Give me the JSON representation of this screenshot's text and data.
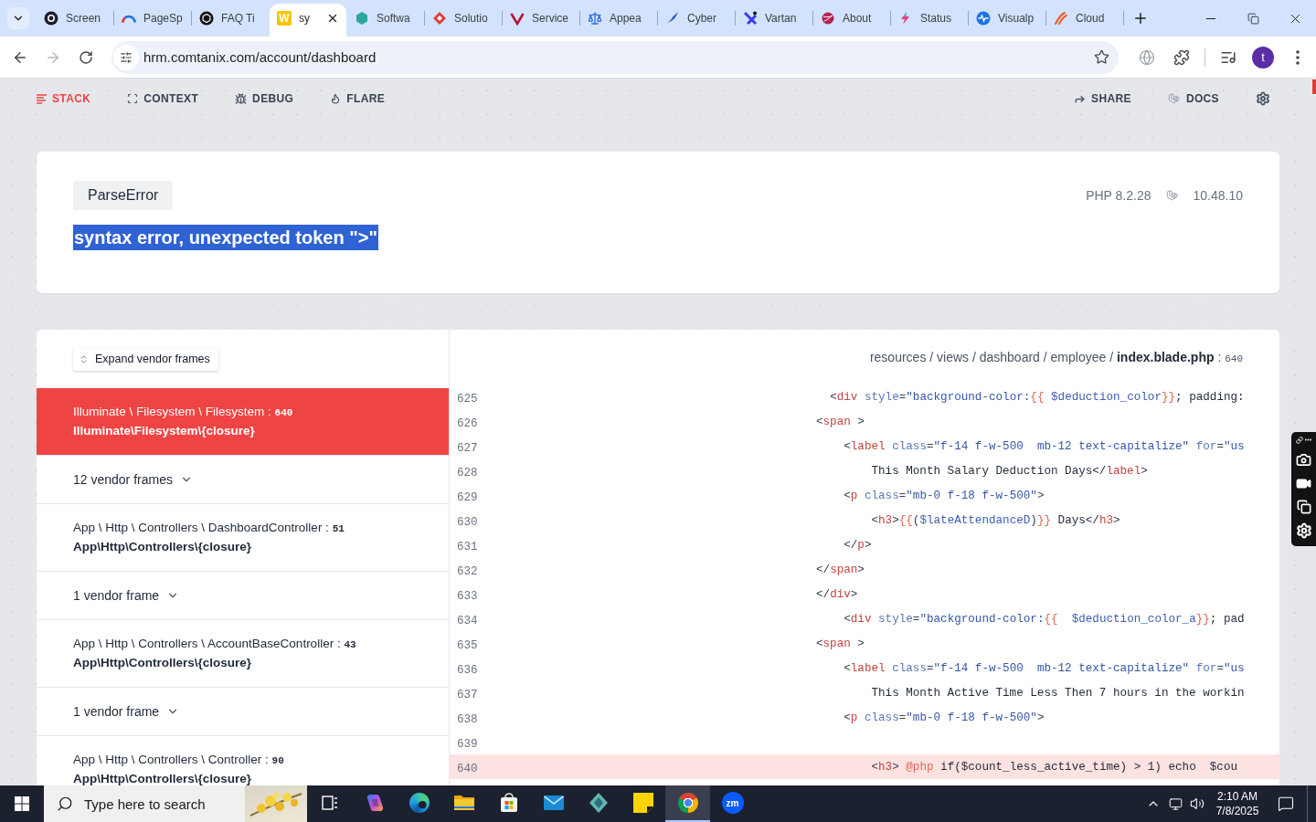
{
  "browser": {
    "tabs": [
      {
        "title": "Screen",
        "selected": false
      },
      {
        "title": "PageSp",
        "selected": false
      },
      {
        "title": "FAQ Ti",
        "selected": false
      },
      {
        "title": "sy",
        "selected": true,
        "favicon_text": "W"
      },
      {
        "title": "Softwa",
        "selected": false
      },
      {
        "title": "Solutio",
        "selected": false
      },
      {
        "title": "Service",
        "selected": false
      },
      {
        "title": "Appea",
        "selected": false
      },
      {
        "title": "Cyber",
        "selected": false
      },
      {
        "title": "Vartan",
        "selected": false
      },
      {
        "title": "About",
        "selected": false
      },
      {
        "title": "Status",
        "selected": false
      },
      {
        "title": "Visualp",
        "selected": false
      },
      {
        "title": "Cloud",
        "selected": false
      }
    ],
    "navigation": {
      "back_disabled": false,
      "forward_disabled": true
    },
    "address": {
      "url": "hrm.comtanix.com/account/dashboard"
    },
    "profile": {
      "initial": "t"
    }
  },
  "page": {
    "nav": {
      "left": [
        {
          "label": "STACK",
          "selected": true
        },
        {
          "label": "CONTEXT",
          "selected": false
        },
        {
          "label": "DEBUG",
          "selected": false
        },
        {
          "label": "FLARE",
          "selected": false
        }
      ],
      "right": [
        {
          "label": "SHARE"
        },
        {
          "label": "DOCS"
        }
      ]
    },
    "exception": {
      "class": "ParseError",
      "message": "syntax error, unexpected token \">\"",
      "text_selected": true,
      "php_version": "PHP 8.2.28",
      "laravel_version": "10.48.10"
    },
    "stack": {
      "expand_label": "Expand vendor frames",
      "frames": [
        {
          "kind": "frame",
          "location": "Illuminate \\ Filesystem \\ Filesystem :",
          "line": "640",
          "method": "Illuminate\\Filesystem\\{closure}",
          "selected": true
        },
        {
          "kind": "vendor_group",
          "label": "12 vendor frames",
          "expanded": false
        },
        {
          "kind": "frame",
          "location": "App \\ Http \\ Controllers \\ DashboardController :",
          "line": "51",
          "method": "App\\Http\\Controllers\\{closure}",
          "selected": false
        },
        {
          "kind": "vendor_group",
          "label": "1 vendor frame",
          "expanded": false
        },
        {
          "kind": "frame",
          "location": "App \\ Http \\ Controllers \\ AccountBaseController :",
          "line": "43",
          "method": "App\\Http\\Controllers\\{closure}",
          "selected": false
        },
        {
          "kind": "vendor_group",
          "label": "1 vendor frame",
          "expanded": false
        },
        {
          "kind": "frame",
          "location": "App \\ Http \\ Controllers \\ Controller :",
          "line": "90",
          "method": "App\\Http\\Controllers\\{closure}",
          "selected": false
        }
      ],
      "file": {
        "directory": "resources / views / dashboard / employee /",
        "file": "index.blade.php",
        "separator": ":",
        "line": "640"
      },
      "code_lines": [
        {
          "number": "625",
          "highlighted": false,
          "tokens": [
            {
              "kind": "punct",
              "text": "  <"
            },
            {
              "kind": "tag",
              "text": "div"
            },
            {
              "kind": "attr",
              "text": " style"
            },
            {
              "kind": "punct",
              "text": "="
            },
            {
              "kind": "string",
              "text": "\"background-color:"
            },
            {
              "kind": "blade",
              "text": "{{"
            },
            {
              "kind": "var",
              "text": " $deduction_color"
            },
            {
              "kind": "blade",
              "text": "}}"
            },
            {
              "kind": "text",
              "text": "; padding:"
            }
          ]
        },
        {
          "number": "626",
          "highlighted": false,
          "tokens": [
            {
              "kind": "punct",
              "text": "<"
            },
            {
              "kind": "tag",
              "text": "span"
            },
            {
              "kind": "punct",
              "text": " >"
            }
          ]
        },
        {
          "number": "627",
          "highlighted": false,
          "tokens": [
            {
              "kind": "punct",
              "text": "    <"
            },
            {
              "kind": "tag",
              "text": "label"
            },
            {
              "kind": "attr",
              "text": " class"
            },
            {
              "kind": "punct",
              "text": "="
            },
            {
              "kind": "string",
              "text": "\"f-14 f-w-500  mb-12 text-capitalize\""
            },
            {
              "kind": "attr",
              "text": " for"
            },
            {
              "kind": "punct",
              "text": "="
            },
            {
              "kind": "string",
              "text": "\"us"
            }
          ]
        },
        {
          "number": "628",
          "highlighted": false,
          "tokens": [
            {
              "kind": "text",
              "text": "        This Month Salary Deduction Days</"
            },
            {
              "kind": "tag",
              "text": "label"
            },
            {
              "kind": "punct",
              "text": ">"
            }
          ]
        },
        {
          "number": "629",
          "highlighted": false,
          "tokens": [
            {
              "kind": "punct",
              "text": "    <"
            },
            {
              "kind": "tag",
              "text": "p"
            },
            {
              "kind": "attr",
              "text": " class"
            },
            {
              "kind": "punct",
              "text": "="
            },
            {
              "kind": "string",
              "text": "\"mb-0 f-18 f-w-500\""
            },
            {
              "kind": "punct",
              "text": ">"
            }
          ]
        },
        {
          "number": "630",
          "highlighted": false,
          "tokens": [
            {
              "kind": "punct",
              "text": "        <"
            },
            {
              "kind": "tag",
              "text": "h3"
            },
            {
              "kind": "punct",
              "text": ">"
            },
            {
              "kind": "blade",
              "text": "{{"
            },
            {
              "kind": "punct",
              "text": "("
            },
            {
              "kind": "var",
              "text": "$lateAttendanceD"
            },
            {
              "kind": "punct",
              "text": ")"
            },
            {
              "kind": "blade",
              "text": "}}"
            },
            {
              "kind": "text",
              "text": " Days</"
            },
            {
              "kind": "tag",
              "text": "h3"
            },
            {
              "kind": "punct",
              "text": ">"
            }
          ]
        },
        {
          "number": "631",
          "highlighted": false,
          "tokens": [
            {
              "kind": "punct",
              "text": "    </"
            },
            {
              "kind": "tag",
              "text": "p"
            },
            {
              "kind": "punct",
              "text": ">"
            }
          ]
        },
        {
          "number": "632",
          "highlighted": false,
          "tokens": [
            {
              "kind": "punct",
              "text": "</"
            },
            {
              "kind": "tag",
              "text": "span"
            },
            {
              "kind": "punct",
              "text": ">"
            }
          ]
        },
        {
          "number": "633",
          "highlighted": false,
          "tokens": [
            {
              "kind": "punct",
              "text": "</"
            },
            {
              "kind": "tag",
              "text": "div"
            },
            {
              "kind": "punct",
              "text": ">"
            }
          ]
        },
        {
          "number": "634",
          "highlighted": false,
          "tokens": [
            {
              "kind": "punct",
              "text": "    <"
            },
            {
              "kind": "tag",
              "text": "div"
            },
            {
              "kind": "attr",
              "text": " style"
            },
            {
              "kind": "punct",
              "text": "="
            },
            {
              "kind": "string",
              "text": "\"background-color:"
            },
            {
              "kind": "blade",
              "text": "{{"
            },
            {
              "kind": "var",
              "text": "  $deduction_color_a"
            },
            {
              "kind": "blade",
              "text": "}}"
            },
            {
              "kind": "text",
              "text": "; pad"
            }
          ]
        },
        {
          "number": "635",
          "highlighted": false,
          "tokens": [
            {
              "kind": "punct",
              "text": "<"
            },
            {
              "kind": "tag",
              "text": "span"
            },
            {
              "kind": "punct",
              "text": " >"
            }
          ]
        },
        {
          "number": "636",
          "highlighted": false,
          "tokens": [
            {
              "kind": "punct",
              "text": "    <"
            },
            {
              "kind": "tag",
              "text": "label"
            },
            {
              "kind": "attr",
              "text": " class"
            },
            {
              "kind": "punct",
              "text": "="
            },
            {
              "kind": "string",
              "text": "\"f-14 f-w-500  mb-12 text-capitalize\""
            },
            {
              "kind": "attr",
              "text": " for"
            },
            {
              "kind": "punct",
              "text": "="
            },
            {
              "kind": "string",
              "text": "\"us"
            }
          ]
        },
        {
          "number": "637",
          "highlighted": false,
          "tokens": [
            {
              "kind": "text",
              "text": "        This Month Active Time Less Then 7 hours in the workin"
            }
          ]
        },
        {
          "number": "638",
          "highlighted": false,
          "tokens": [
            {
              "kind": "punct",
              "text": "    <"
            },
            {
              "kind": "tag",
              "text": "p"
            },
            {
              "kind": "attr",
              "text": " class"
            },
            {
              "kind": "punct",
              "text": "="
            },
            {
              "kind": "string",
              "text": "\"mb-0 f-18 f-w-500\""
            },
            {
              "kind": "punct",
              "text": ">"
            }
          ]
        },
        {
          "number": "639",
          "highlighted": false
        },
        {
          "number": "640",
          "highlighted": true,
          "tokens": [
            {
              "kind": "punct",
              "text": "        <"
            },
            {
              "kind": "tag",
              "text": "h3"
            },
            {
              "kind": "punct",
              "text": ">"
            },
            {
              "kind": "blade",
              "text": " @php"
            },
            {
              "kind": "text",
              "text": " if($count_less_active_time) > 1) echo  $cou"
            }
          ]
        }
      ]
    }
  },
  "taskbar": {
    "search_placeholder": "Type here to search",
    "apps": [
      {
        "selected": false
      },
      {
        "selected": false
      },
      {
        "selected": false
      },
      {
        "selected": false
      },
      {
        "selected": false
      },
      {
        "selected": false
      },
      {
        "selected": false
      },
      {
        "selected": true
      },
      {
        "selected": false,
        "logo_text": "zm"
      }
    ],
    "clock": {
      "time": "2:10 AM",
      "date": "7/8/2025"
    }
  }
}
